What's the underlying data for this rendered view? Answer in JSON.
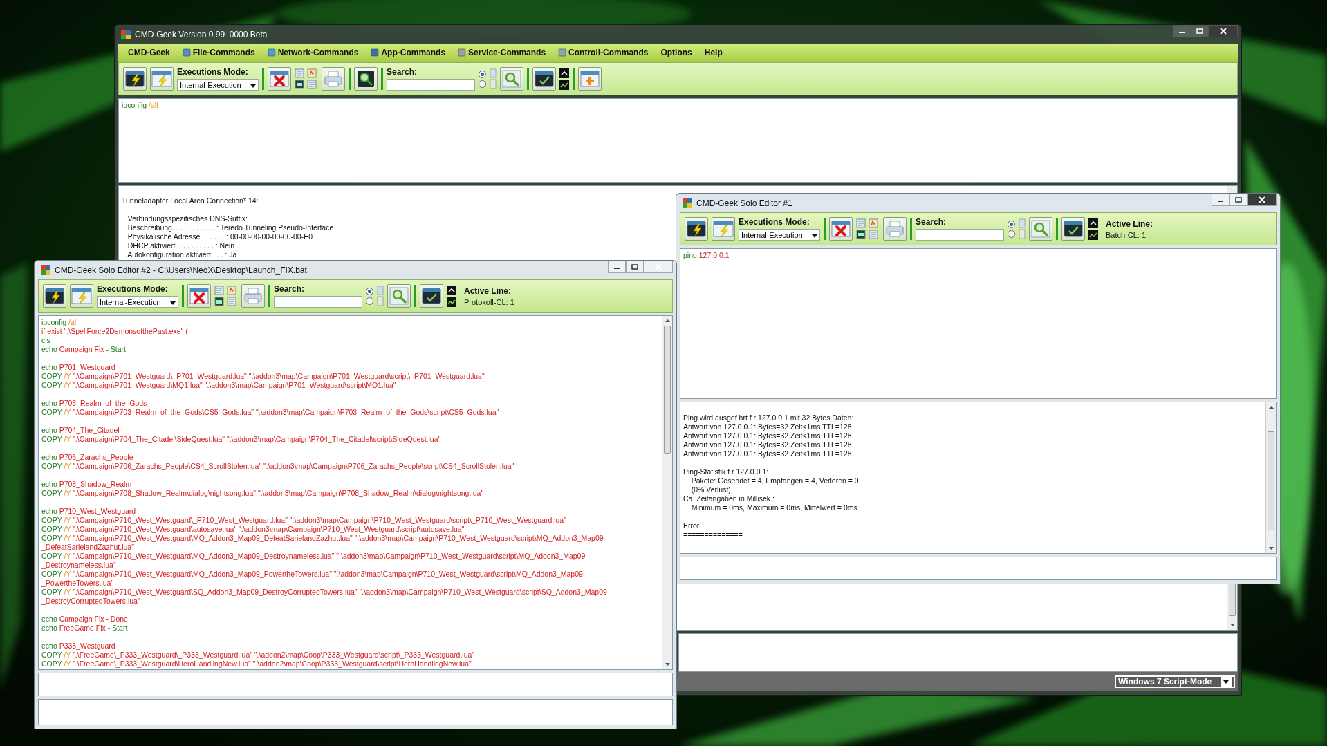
{
  "main_window": {
    "title": "CMD-Geek Version 0.99_0000 Beta",
    "menu": [
      {
        "label": "CMD-Geek",
        "has_icon": false
      },
      {
        "label": "File-Commands",
        "has_icon": true
      },
      {
        "label": "Network-Commands",
        "has_icon": true
      },
      {
        "label": "App-Commands",
        "has_icon": true
      },
      {
        "label": "Service-Commands",
        "has_icon": true
      },
      {
        "label": "Controll-Commands",
        "has_icon": true
      },
      {
        "label": "Options",
        "has_icon": false
      },
      {
        "label": "Help",
        "has_icon": false
      }
    ],
    "toolbar": {
      "kind": "main",
      "mode_label": "Executions Mode:",
      "mode_value": "Internal-Execution",
      "search_label": "Search:",
      "search_options": [
        {
          "selected": true
        },
        {
          "selected": false
        }
      ]
    },
    "input": {
      "blocks": [
        [
          [
            {
              "text": "ipconfig ",
              "kind": "command"
            },
            {
              "text": "/all",
              "kind": "switch"
            }
          ]
        ]
      ]
    },
    "output": {
      "blocks": [
        [
          "Tunneladapter Local Area Connection* 14:"
        ],
        [
          "   Verbindungsspezifisches DNS-Suffix:",
          "   Beschreibung. . . . . . . . . . . : Teredo Tunneling Pseudo-Interface",
          "   Physikalische Adresse . . . . . . : 00-00-00-00-00-00-00-E0",
          "   DHCP aktiviert. . . . . . . . . . : Nein",
          "   Autokonfiguration aktiviert . . . : Ja"
        ]
      ]
    },
    "script_mode": "Windows 7 Script-Mode"
  },
  "solo_editor_1": {
    "title": "CMD-Geek Solo Editor #1",
    "toolbar": {
      "kind": "editor",
      "mode_label": "Executions Mode:",
      "mode_value": "Internal-Execution",
      "search_label": "Search:",
      "search_options": [
        {
          "selected": true
        },
        {
          "selected": false
        }
      ],
      "active_line_label": "Active Line:",
      "active_line_value": "Batch-CL: 1"
    },
    "input": {
      "blocks": [
        [
          [
            {
              "text": "ping ",
              "kind": "command"
            },
            {
              "text": "127.0.0.1",
              "kind": "text"
            }
          ]
        ]
      ]
    },
    "output": {
      "blocks": [
        [
          "Ping wird ausgef hrt f r 127.0.0.1 mit 32 Bytes Daten:",
          "Antwort von 127.0.0.1: Bytes=32 Zeit<1ms TTL=128",
          "Antwort von 127.0.0.1: Bytes=32 Zeit<1ms TTL=128",
          "Antwort von 127.0.0.1: Bytes=32 Zeit<1ms TTL=128",
          "Antwort von 127.0.0.1: Bytes=32 Zeit<1ms TTL=128"
        ],
        [
          "Ping-Statistik f r 127.0.0.1:",
          "    Pakete: Gesendet = 4, Empfangen = 4, Verloren = 0",
          "    (0% Verlust),",
          "Ca. Zeitangaben in Millisek.:",
          "    Minimum = 0ms, Maximum = 0ms, Mittelwert = 0ms"
        ],
        [
          "Error",
          "=============="
        ]
      ]
    }
  },
  "solo_editor_2": {
    "title": "CMD-Geek Solo Editor #2 - C:\\Users\\NeoX\\Desktop\\Launch_FIX.bat",
    "toolbar": {
      "kind": "editor",
      "mode_label": "Executions Mode:",
      "mode_value": "Internal-Execution",
      "search_label": "Search:",
      "search_options": [
        {
          "selected": true
        },
        {
          "selected": false
        }
      ],
      "active_line_label": "Active Line:",
      "active_line_value": "Protokoll-CL: 1"
    },
    "input": {
      "blocks": [
        [
          [
            {
              "text": "ipconfig ",
              "kind": "command"
            },
            {
              "text": "/all",
              "kind": "switch"
            }
          ],
          [
            {
              "text": "if exist \".\\SpellForce2DemonsofthePast.exe\" (",
              "kind": "text"
            }
          ],
          [
            {
              "text": "cls",
              "kind": "command"
            }
          ],
          [
            {
              "text": "echo ",
              "kind": "command"
            },
            {
              "text": "Campaign Fix",
              "kind": "text"
            },
            {
              "text": " - Start",
              "kind": "command"
            }
          ]
        ],
        [
          [
            {
              "text": "echo ",
              "kind": "command"
            },
            {
              "text": "P701_Westguard",
              "kind": "text"
            }
          ],
          [
            {
              "text": "COPY ",
              "kind": "command"
            },
            {
              "text": "/Y ",
              "kind": "switch"
            },
            {
              "text": "\".\\Campaign\\P701_Westguard\\_P701_Westguard.lua\" \".\\addon3\\map\\Campaign\\P701_Westguard\\script\\_P701_Westguard.lua\"",
              "kind": "text"
            }
          ],
          [
            {
              "text": "COPY ",
              "kind": "command"
            },
            {
              "text": "/Y ",
              "kind": "switch"
            },
            {
              "text": "\".\\Campaign\\P701_Westguard\\MQ1.lua\" \".\\addon3\\map\\Campaign\\P701_Westguard\\script\\MQ1.lua\"",
              "kind": "text"
            }
          ]
        ],
        [
          [
            {
              "text": "echo ",
              "kind": "command"
            },
            {
              "text": "P703_Realm_of_the_Gods",
              "kind": "text"
            }
          ],
          [
            {
              "text": "COPY ",
              "kind": "command"
            },
            {
              "text": "/Y ",
              "kind": "switch"
            },
            {
              "text": "\".\\Campaign\\P703_Realm_of_the_Gods\\CS5_Gods.lua\" \".\\addon3\\map\\Campaign\\P703_Realm_of_the_Gods\\script\\CS5_Gods.lua\"",
              "kind": "text"
            }
          ]
        ],
        [
          [
            {
              "text": "echo ",
              "kind": "command"
            },
            {
              "text": "P704_The_Citadel",
              "kind": "text"
            }
          ],
          [
            {
              "text": "COPY ",
              "kind": "command"
            },
            {
              "text": "/Y ",
              "kind": "switch"
            },
            {
              "text": "\".\\Campaign\\P704_The_Citadel\\SideQuest.lua\" \".\\addon3\\map\\Campaign\\P704_The_Citadel\\script\\SideQuest.lua\"",
              "kind": "text"
            }
          ]
        ],
        [
          [
            {
              "text": "echo ",
              "kind": "command"
            },
            {
              "text": "P706_Zarachs_People",
              "kind": "text"
            }
          ],
          [
            {
              "text": "COPY ",
              "kind": "command"
            },
            {
              "text": "/Y ",
              "kind": "switch"
            },
            {
              "text": "\".\\Campaign\\P706_Zarachs_People\\CS4_ScrollStolen.lua\" \".\\addon3\\map\\Campaign\\P706_Zarachs_People\\script\\CS4_ScrollStolen.lua\"",
              "kind": "text"
            }
          ]
        ],
        [
          [
            {
              "text": "echo ",
              "kind": "command"
            },
            {
              "text": "P708_Shadow_Realm",
              "kind": "text"
            }
          ],
          [
            {
              "text": "COPY ",
              "kind": "command"
            },
            {
              "text": "/Y ",
              "kind": "switch"
            },
            {
              "text": "\".\\Campaign\\P708_Shadow_Realm\\dialog\\nightsong.lua\" \".\\addon3\\map\\Campaign\\P708_Shadow_Realm\\dialog\\nightsong.lua\"",
              "kind": "text"
            }
          ]
        ],
        [
          [
            {
              "text": "echo ",
              "kind": "command"
            },
            {
              "text": "P710_West_Westguard",
              "kind": "text"
            }
          ],
          [
            {
              "text": "COPY ",
              "kind": "command"
            },
            {
              "text": "/Y ",
              "kind": "switch"
            },
            {
              "text": "\".\\Campaign\\P710_West_Westguard\\_P710_West_Westguard.lua\" \".\\addon3\\map\\Campaign\\P710_West_Westguard\\script\\_P710_West_Westguard.lua\"",
              "kind": "text"
            }
          ],
          [
            {
              "text": "COPY ",
              "kind": "command"
            },
            {
              "text": "/Y ",
              "kind": "switch"
            },
            {
              "text": "\".\\Campaign\\P710_West_Westguard\\autosave.lua\" \".\\addon3\\map\\Campaign\\P710_West_Westguard\\script\\autosave.lua\"",
              "kind": "text"
            }
          ],
          [
            {
              "text": "COPY ",
              "kind": "command"
            },
            {
              "text": "/Y ",
              "kind": "switch"
            },
            {
              "text": "\".\\Campaign\\P710_West_Westguard\\MQ_Addon3_Map09_DefeatSarielandZazhut.lua\" \".\\addon3\\map\\Campaign\\P710_West_Westguard\\script\\MQ_Addon3_Map09",
              "kind": "text"
            }
          ],
          [
            {
              "text": "_DefeatSarielandZazhut.lua\"",
              "kind": "text"
            }
          ],
          [
            {
              "text": "COPY ",
              "kind": "command"
            },
            {
              "text": "/Y ",
              "kind": "switch"
            },
            {
              "text": "\".\\Campaign\\P710_West_Westguard\\MQ_Addon3_Map09_Destroynameless.lua\" \".\\addon3\\map\\Campaign\\P710_West_Westguard\\script\\MQ_Addon3_Map09",
              "kind": "text"
            }
          ],
          [
            {
              "text": "_Destroynameless.lua\"",
              "kind": "text"
            }
          ],
          [
            {
              "text": "COPY ",
              "kind": "command"
            },
            {
              "text": "/Y ",
              "kind": "switch"
            },
            {
              "text": "\".\\Campaign\\P710_West_Westguard\\MQ_Addon3_Map09_PowertheTowers.lua\" \".\\addon3\\map\\Campaign\\P710_West_Westguard\\script\\MQ_Addon3_Map09",
              "kind": "text"
            }
          ],
          [
            {
              "text": "_PowertheTowers.lua\"",
              "kind": "text"
            }
          ],
          [
            {
              "text": "COPY ",
              "kind": "command"
            },
            {
              "text": "/Y ",
              "kind": "switch"
            },
            {
              "text": "\".\\Campaign\\P710_West_Westguard\\SQ_Addon3_Map09_DestroyCorruptedTowers.lua\" \".\\addon3\\map\\Campaign\\P710_West_Westguard\\script\\SQ_Addon3_Map09",
              "kind": "text"
            }
          ],
          [
            {
              "text": "_DestroyCorruptedTowers.lua\"",
              "kind": "text"
            }
          ]
        ],
        [
          [
            {
              "text": "echo ",
              "kind": "command"
            },
            {
              "text": "Campaign Fix - Done",
              "kind": "text"
            }
          ],
          [
            {
              "text": "echo ",
              "kind": "command"
            },
            {
              "text": "FreeGame Fix",
              "kind": "text"
            },
            {
              "text": " - Start",
              "kind": "command"
            }
          ]
        ],
        [
          [
            {
              "text": "echo ",
              "kind": "command"
            },
            {
              "text": "P333_Westguard",
              "kind": "text"
            }
          ],
          [
            {
              "text": "COPY ",
              "kind": "command"
            },
            {
              "text": "/Y ",
              "kind": "switch"
            },
            {
              "text": "\".\\FreeGame\\_P333_Westguard\\_P333_Westguard.lua\" \".\\addon2\\map\\Coop\\P333_Westguard\\script\\_P333_Westguard.lua\"",
              "kind": "text"
            }
          ],
          [
            {
              "text": "COPY ",
              "kind": "command"
            },
            {
              "text": "/Y ",
              "kind": "switch"
            },
            {
              "text": "\".\\FreeGame\\_P333_Westguard\\HeroHandlingNew.lua\" \".\\addon2\\map\\Coop\\P333_Westguard\\script\\HeroHandlingNew.lua\"",
              "kind": "text"
            }
          ]
        ]
      ]
    }
  }
}
